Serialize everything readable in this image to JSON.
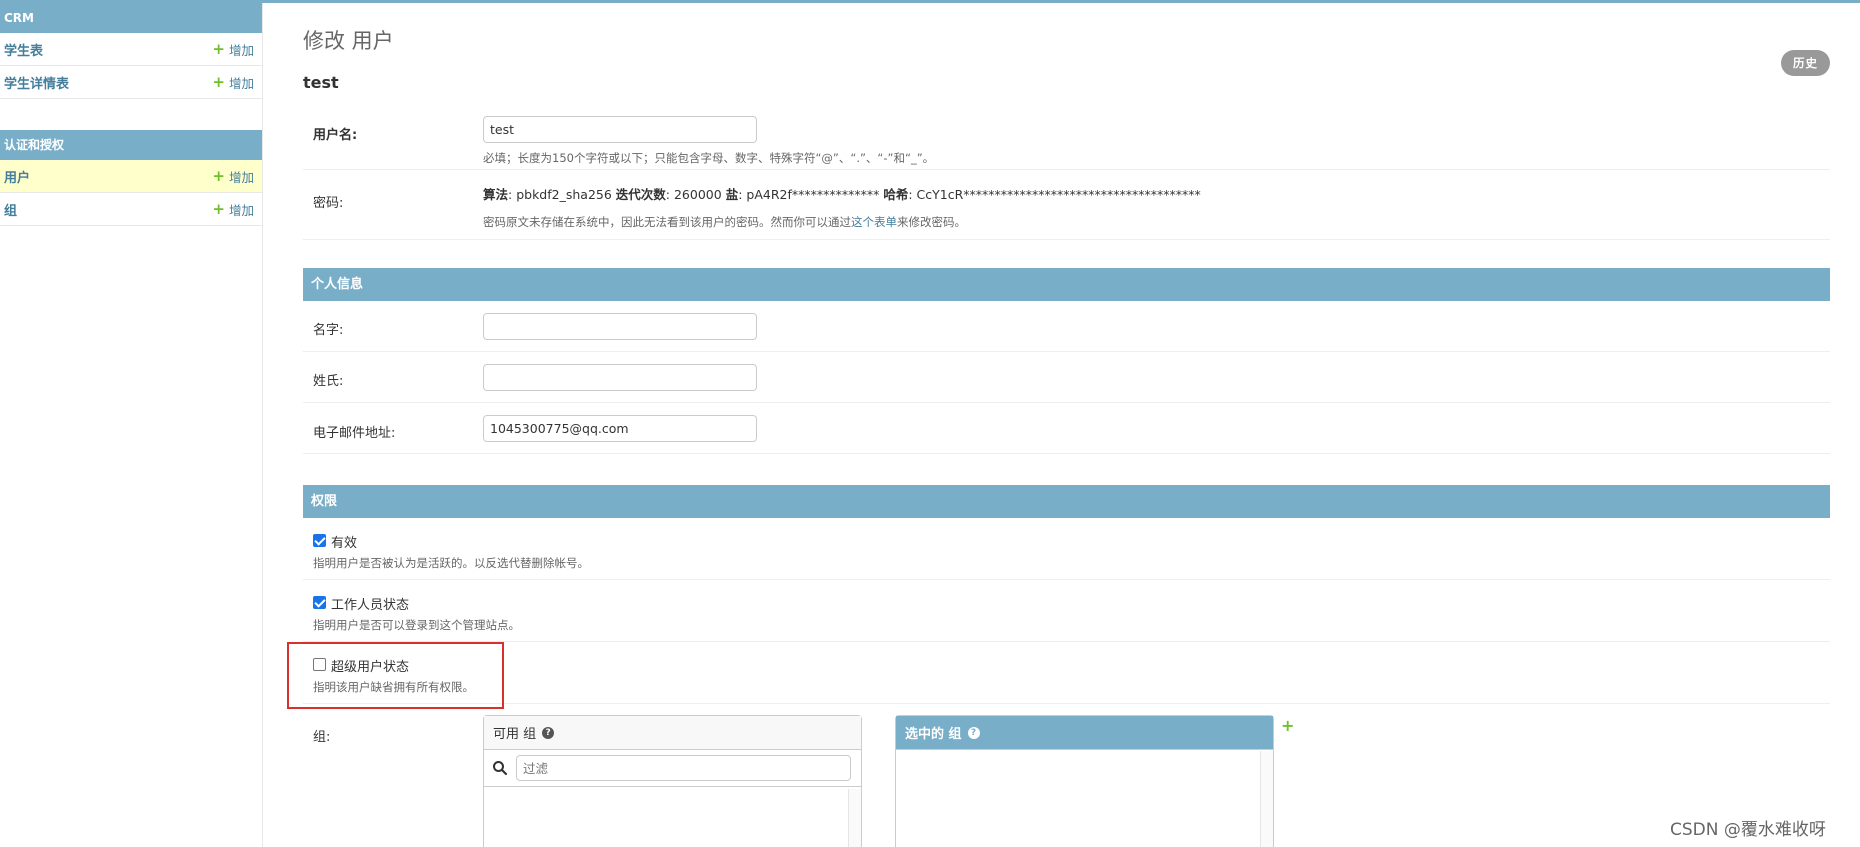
{
  "sidebar": {
    "apps": [
      {
        "caption": "CRM",
        "models": [
          {
            "name": "学生表",
            "add": "增加",
            "current": false
          },
          {
            "name": "学生详情表",
            "add": "增加",
            "current": false
          }
        ]
      },
      {
        "caption": "认证和授权",
        "models": [
          {
            "name": "用户",
            "add": "增加",
            "current": true
          },
          {
            "name": "组",
            "add": "增加",
            "current": false
          }
        ]
      }
    ]
  },
  "main": {
    "title": "修改 用户",
    "object_name": "test",
    "history_button": "历史",
    "username": {
      "label": "用户名:",
      "value": "test",
      "help": "必填；长度为150个字符或以下；只能包含字母、数字、特殊字符“@”、“.”、“-”和“_”。"
    },
    "password": {
      "label": "密码:",
      "algorithm_label": "算法",
      "algorithm_value": ": pbkdf2_sha256 ",
      "iterations_label": "迭代次数",
      "iterations_value": ": 260000 ",
      "salt_label": "盐",
      "salt_value": ": pA4R2f************** ",
      "hash_label": "哈希",
      "hash_value": ": CcY1cR**************************************",
      "help_before": "密码原文未存储在系统中，因此无法看到该用户的密码。然而你可以通过",
      "help_link": "这个表单",
      "help_after": "来修改密码。"
    },
    "personal_info": {
      "heading": "个人信息",
      "first_name": {
        "label": "名字:",
        "value": ""
      },
      "last_name": {
        "label": "姓氏:",
        "value": ""
      },
      "email": {
        "label": "电子邮件地址:",
        "value": "1045300775@qq.com"
      }
    },
    "permissions": {
      "heading": "权限",
      "active": {
        "label": "有效",
        "checked": true,
        "help": "指明用户是否被认为是活跃的。以反选代替删除帐号。"
      },
      "staff": {
        "label": "工作人员状态",
        "checked": true,
        "help": "指明用户是否可以登录到这个管理站点。"
      },
      "superuser": {
        "label": "超级用户状态",
        "checked": false,
        "help": "指明该用户缺省拥有所有权限。"
      },
      "groups": {
        "label": "组:",
        "available_title": "可用 组",
        "filter_placeholder": "过滤",
        "chosen_title": "选中的 组",
        "add_icon": "+"
      }
    }
  },
  "watermark": "CSDN @覆水难收呀",
  "colors": {
    "header": "#79aec8",
    "link": "#447e9b",
    "add_green": "#70bf2b",
    "highlight": "#ffffcc",
    "annotation_red": "#d9302c"
  }
}
